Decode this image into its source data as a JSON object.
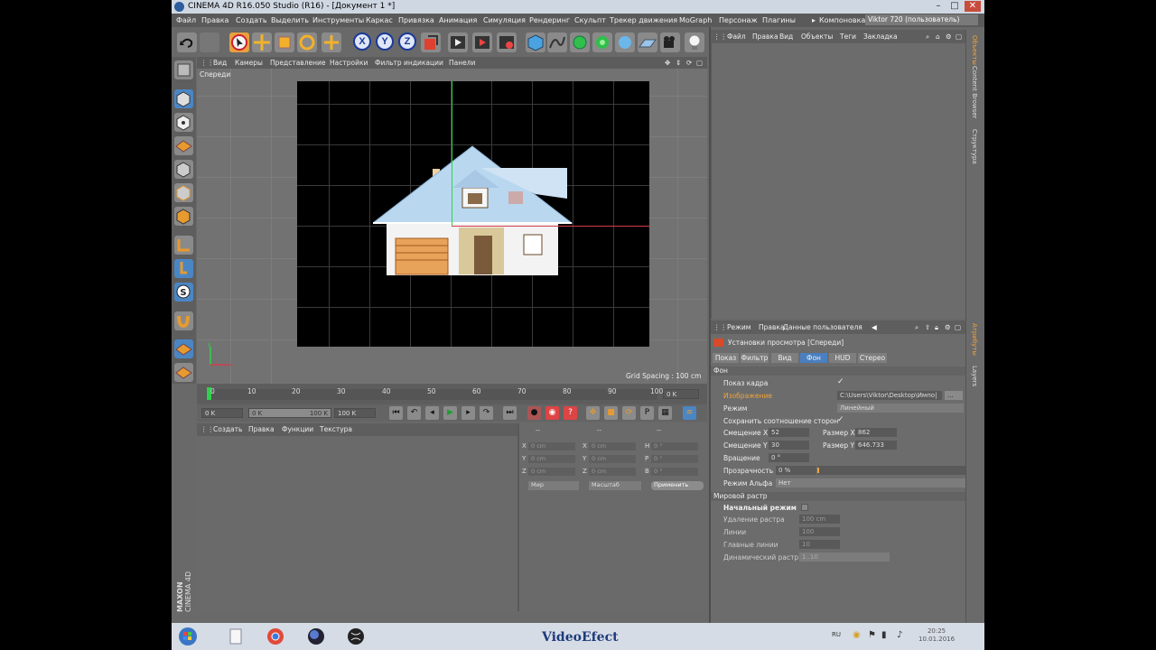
{
  "window": {
    "title": "CINEMA 4D R16.050 Studio (R16) - [Документ 1 *]"
  },
  "menubar": {
    "items": [
      "Файл",
      "Правка",
      "Создать",
      "Выделить",
      "Инструменты",
      "Каркас",
      "Привязка",
      "Анимация",
      "Симуляция",
      "Рендеринг",
      "Скульпт",
      "Трекер движения",
      "MoGraph",
      "Персонаж",
      "Плагины"
    ],
    "layout_label": "Компоновка",
    "layout_value": "Viktor 720 (пользователь)"
  },
  "viewport": {
    "menu": [
      "Вид",
      "Камеры",
      "Представление",
      "Настройки",
      "Фильтр индикации",
      "Панели"
    ],
    "view_name": "Спереди",
    "grid_spacing": "Grid Spacing : 100 cm"
  },
  "timeline": {
    "ticks": [
      "0",
      "10",
      "20",
      "30",
      "40",
      "50",
      "60",
      "70",
      "80",
      "90",
      "100"
    ],
    "current_frame": "0 K"
  },
  "transport": {
    "start": "0 K",
    "range_start": "0 K",
    "range_end": "100 K",
    "end": "100 K"
  },
  "material_panel": {
    "menu": [
      "Создать",
      "Правка",
      "Функции",
      "Текстура"
    ]
  },
  "coord_panel": {
    "header": [
      "--",
      "--",
      "--"
    ],
    "rows": [
      {
        "a": "X",
        "av": "0 cm",
        "b": "X",
        "bv": "0 cm",
        "c": "H",
        "cv": "0 °"
      },
      {
        "a": "Y",
        "av": "0 cm",
        "b": "Y",
        "bv": "0 cm",
        "c": "P",
        "cv": "0 °"
      },
      {
        "a": "Z",
        "av": "0 cm",
        "b": "Z",
        "bv": "0 cm",
        "c": "B",
        "cv": "0 °"
      }
    ],
    "space": "Мир",
    "scale": "Масштаб",
    "apply": "Применить"
  },
  "object_manager": {
    "menu": [
      "Файл",
      "Правка",
      "Вид",
      "Объекты",
      "Теги",
      "Закладка"
    ]
  },
  "side_tabs": {
    "top": [
      "Объекты",
      "Content Browser",
      "Структура"
    ],
    "bottom": [
      "Атрибуты",
      "Layers"
    ]
  },
  "attributes": {
    "menu": [
      "Режим",
      "Правка",
      "Данные пользователя"
    ],
    "title": "Установки просмотра [Спереди]",
    "tabs": [
      "Показ",
      "Фильтр",
      "Вид",
      "Фон",
      "HUD",
      "Стерео"
    ],
    "section_bg": "Фон",
    "show_frame": "Показ кадра",
    "image_label": "Изображение",
    "image_path": "C:\\Users\\Viktor\\Desktop\\Импо|",
    "image_browse": "...",
    "mode_label": "Режим",
    "mode_value": "Линейный",
    "keep_aspect": "Сохранить соотношение сторон",
    "offset_x_label": "Смещение X",
    "offset_x": "52",
    "size_x_label": "Размер X",
    "size_x": "862",
    "offset_y_label": "Смещение Y",
    "offset_y": "30",
    "size_y_label": "Размер Y",
    "size_y": "646.733",
    "rotation_label": "Вращение",
    "rotation": "0 °",
    "transparency_label": "Прозрачность",
    "transparency": "0 %",
    "alpha_label": "Режим Альфа",
    "alpha_value": "Нет",
    "section_world": "Мировой растр",
    "initial_mode": "Начальный режим",
    "grid_distance_label": "Удаление растра",
    "grid_distance": "100 cm",
    "lines_label": "Линии",
    "lines": "100",
    "major_lines_label": "Главные линии",
    "major_lines": "10",
    "dynamic_label": "Динамический растр",
    "dynamic_value": "1..10"
  },
  "branding": {
    "maxon": "MAXON",
    "cinema": "CINEMA 4D"
  },
  "taskbar": {
    "brand": "VideoEfect",
    "lang": "RU",
    "time": "20:25",
    "date": "10.01.2016"
  },
  "colors": {
    "accent_orange": "#f2a33a",
    "axis_green": "#2fd04a",
    "axis_red": "#d83a4a",
    "tab_active": "#4a7fc0"
  }
}
